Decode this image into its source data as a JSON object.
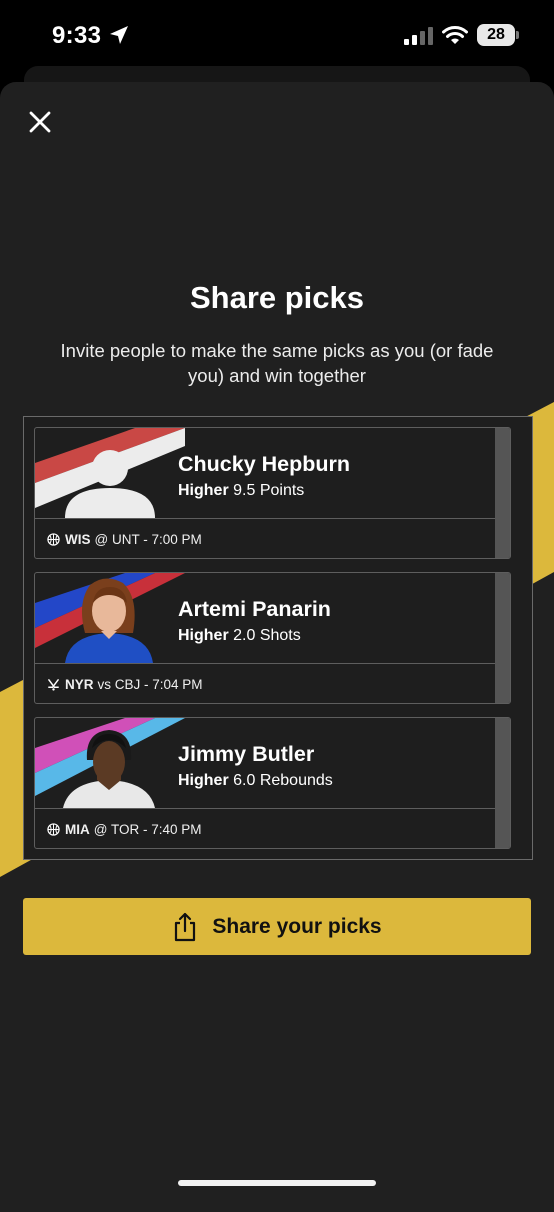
{
  "status_bar": {
    "time": "9:33",
    "battery": "28"
  },
  "sheet": {
    "title": "Share picks",
    "subtitle": "Invite people to make the same picks as you (or fade you) and win together"
  },
  "picks": [
    {
      "player": "Chucky Hepburn",
      "direction": "Higher",
      "line": "9.5 Points",
      "sport_icon": "basketball-icon",
      "team": "WIS",
      "matchup": "@ UNT - 7:00 PM",
      "stripe_colors": [
        "#c94845",
        "#ececec"
      ]
    },
    {
      "player": "Artemi Panarin",
      "direction": "Higher",
      "line": "2.0 Shots",
      "sport_icon": "hockey-icon",
      "team": "NYR",
      "matchup": "vs CBJ - 7:04 PM",
      "stripe_colors": [
        "#2347c8",
        "#c8303a"
      ]
    },
    {
      "player": "Jimmy Butler",
      "direction": "Higher",
      "line": "6.0 Rebounds",
      "sport_icon": "basketball-icon",
      "team": "MIA",
      "matchup": "@ TOR - 7:40 PM",
      "stripe_colors": [
        "#d050b8",
        "#58b8e8"
      ]
    }
  ],
  "share_button": {
    "label": "Share your picks",
    "icon": "share-icon"
  },
  "colors": {
    "accent": "#dcb83c",
    "sheet_bg": "#202020"
  }
}
